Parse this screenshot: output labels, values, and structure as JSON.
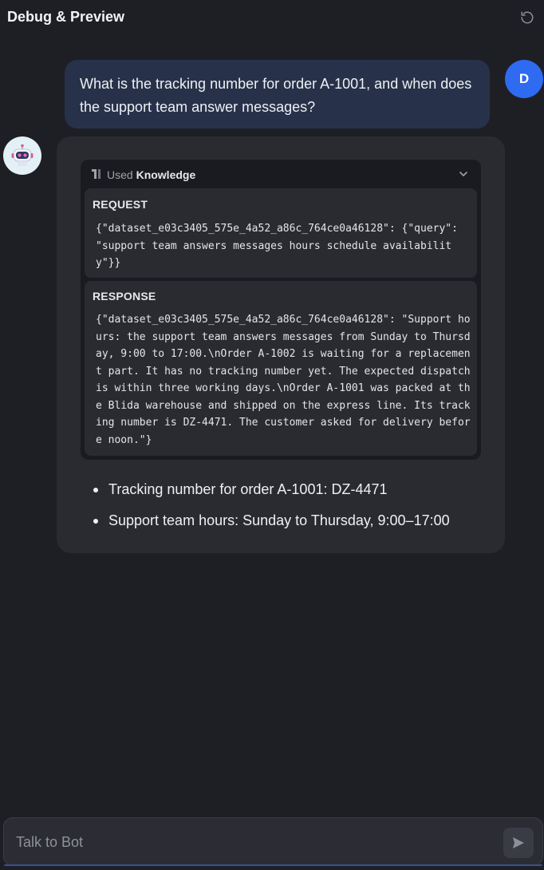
{
  "header": {
    "title": "Debug & Preview"
  },
  "conversation": {
    "user_message": {
      "avatar_letter": "D",
      "text": "What is the tracking number for order A-1001, and when does the support team answer messages?"
    },
    "bot_message": {
      "knowledge": {
        "used_label": "Used",
        "knowledge_label": "Knowledge",
        "request_title": "REQUEST",
        "request_body": "{\"dataset_e03c3405_575e_4a52_a86c_764ce0a46128\": {\"query\": \"support team answers messages hours schedule availability\"}}",
        "response_title": "RESPONSE",
        "response_body": "{\"dataset_e03c3405_575e_4a52_a86c_764ce0a46128\": \"Support hours: the support team answers messages from Sunday to Thursday, 9:00 to 17:00.\\nOrder A-1002 is waiting for a replacement part. It has no tracking number yet. The expected dispatch is within three working days.\\nOrder A-1001 was packed at the Blida warehouse and shipped on the express line. Its tracking number is DZ-4471. The customer asked for delivery before noon.\"}"
      },
      "answer_items": [
        "Tracking number for order A-1001: DZ-4471",
        "Support team hours: Sunday to Thursday, 9:00–17:00"
      ]
    }
  },
  "input": {
    "placeholder": "Talk to Bot",
    "value": ""
  },
  "colors": {
    "background": "#1e1f25",
    "user_bubble": "#27324a",
    "user_avatar": "#2f6bf0",
    "bot_bubble": "#2a2b31",
    "knowledge_panel": "#1a1b20"
  },
  "icons": {
    "refresh": "refresh-icon",
    "bot": "robot-icon",
    "knowledge": "knowledge-icon",
    "collapse": "chevron-down-icon",
    "send": "send-icon"
  }
}
